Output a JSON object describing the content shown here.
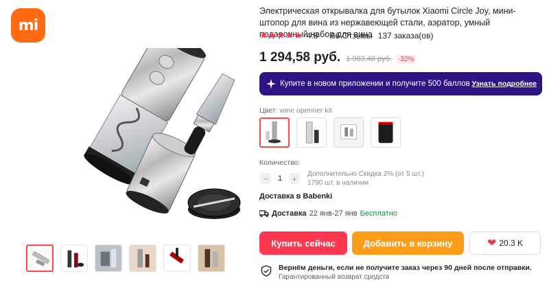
{
  "brand": {
    "logo_text": "mi",
    "color": "#ff6a13"
  },
  "gallery": {
    "thumbnail_count": 7,
    "active_thumbnail": 0
  },
  "product": {
    "title": "Электрическая открывалка для бутылок Xiaomi Circle Joy, мини-штопор для вина из нержавеющей стали, аэратор, умный подарочный набор для вина",
    "rating": "4.8",
    "stars": "★★★★★",
    "reviews": "66 Отзывы",
    "orders": "137 заказа(ов)",
    "price": "1 294,58 руб.",
    "old_price": "1 903,48 руб.",
    "discount": "-32%"
  },
  "promo": {
    "text": "Купите в новом приложении и получите 500 баллов",
    "link": "Узнать подробнее",
    "bg_color": "#2e1385"
  },
  "color_option": {
    "label": "Цвет:",
    "value": "wine openner kit",
    "selected_index": 0,
    "count": 4
  },
  "quantity": {
    "label": "Количество:",
    "value": "1",
    "minus": "−",
    "plus": "+",
    "note_line1": "Дополнительно Скидка 2% (от 5 шт.)",
    "note_line2": "1790 шт. в наличии"
  },
  "delivery": {
    "to": "Доставка в Babenki",
    "label": "Доставка",
    "dates": "22 янв-27 янв",
    "free": "Бесплатно"
  },
  "actions": {
    "buy": "Купить сейчас",
    "cart": "Добавить в корзину",
    "wishlist_heart": "❤",
    "wishlist_count": "20.3 K",
    "buy_color": "#fd384f",
    "cart_color": "#ff9d18"
  },
  "guarantee": {
    "main": "Вернём деньги, если не получите заказ через 90 дней после отправки.",
    "sub": "Гарантированный возврат средств"
  }
}
